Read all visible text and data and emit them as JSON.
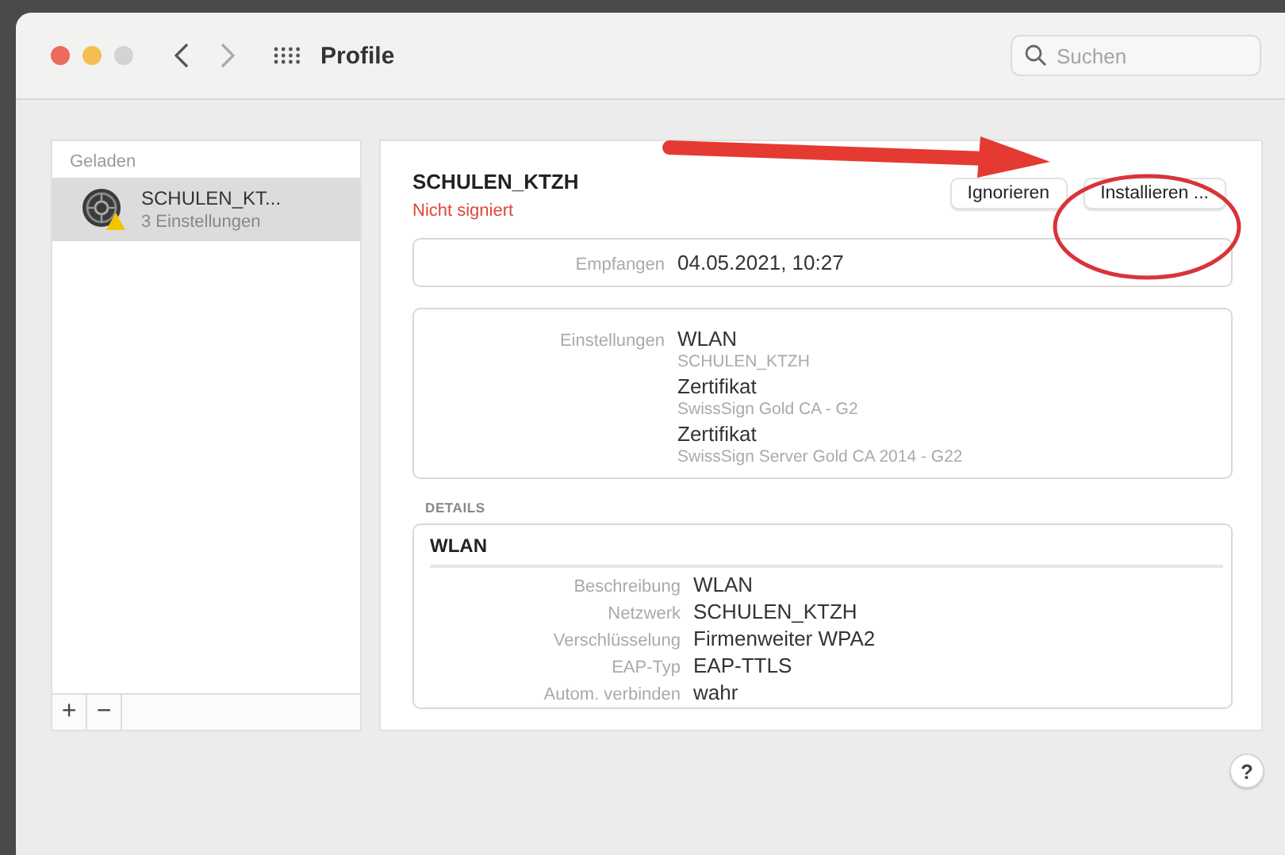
{
  "window": {
    "title": "Profile",
    "search": {
      "placeholder": "Suchen"
    }
  },
  "sidebar": {
    "section": "Geladen",
    "items": [
      {
        "name": "SCHULEN_KT...",
        "subtitle": "3 Einstellungen",
        "selected": true,
        "warning": true
      }
    ],
    "buttons": [
      "+",
      "−"
    ]
  },
  "profile": {
    "name": "SCHULEN_KTZH",
    "status": "Nicht signiert",
    "buttons": [
      "Ignorieren",
      "Installieren ..."
    ]
  },
  "received": {
    "label": "Empfangen",
    "value": "04.05.2021, 10:27"
  },
  "settings": {
    "label": "Einstellungen",
    "items": [
      {
        "title": "WLAN",
        "subtitle": "SCHULEN_KTZH"
      },
      {
        "title": "Zertifikat",
        "subtitle": "SwissSign Gold CA - G2"
      },
      {
        "title": "Zertifikat",
        "subtitle": "SwissSign Server Gold CA 2014 - G22"
      }
    ]
  },
  "details": {
    "heading": "DETAILS",
    "section_title": "WLAN",
    "rows": [
      {
        "label": "Beschreibung",
        "value": "WLAN"
      },
      {
        "label": "Netzwerk",
        "value": "SCHULEN_KTZH"
      },
      {
        "label": "Verschlüsselung",
        "value": "Firmenweiter WPA2"
      },
      {
        "label": "EAP-Typ",
        "value": "EAP-TTLS"
      },
      {
        "label": "Autom. verbinden",
        "value": "wahr"
      }
    ]
  },
  "help": "?"
}
